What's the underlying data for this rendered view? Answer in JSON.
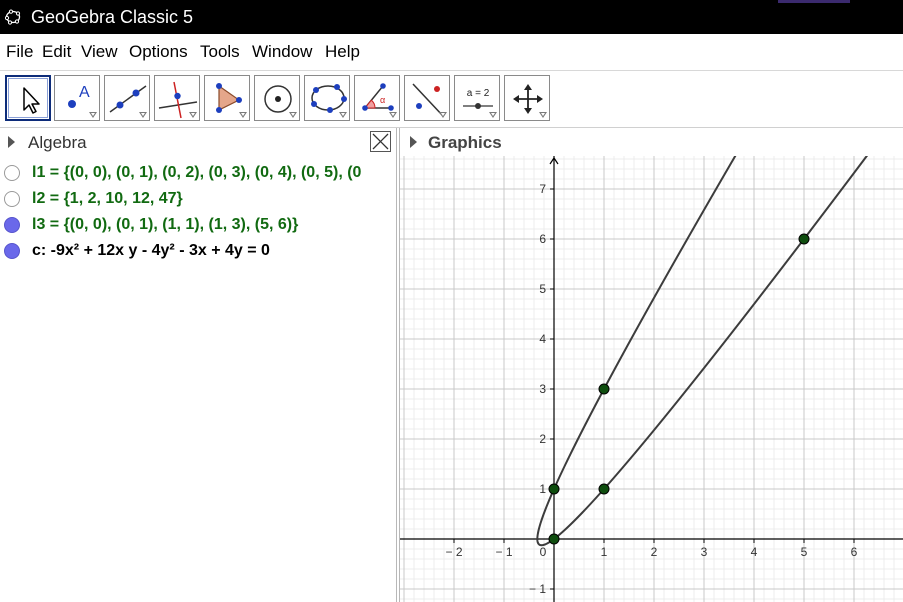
{
  "app": {
    "title": "GeoGebra Classic 5"
  },
  "menu": {
    "items": [
      "File",
      "Edit",
      "View",
      "Options",
      "Tools",
      "Window",
      "Help"
    ]
  },
  "toolbar": {
    "tools": [
      {
        "name": "move-tool",
        "selected": true
      },
      {
        "name": "point-tool",
        "label": "A"
      },
      {
        "name": "line-tool"
      },
      {
        "name": "perpendicular-line-tool"
      },
      {
        "name": "polygon-tool"
      },
      {
        "name": "circle-tool"
      },
      {
        "name": "conic-tool"
      },
      {
        "name": "angle-tool",
        "label": "α"
      },
      {
        "name": "reflect-tool"
      },
      {
        "name": "slider-tool",
        "label": "a = 2"
      },
      {
        "name": "move-graphics-view-tool"
      }
    ]
  },
  "algebra": {
    "header": "Algebra",
    "rows": [
      {
        "text": "l1 = {(0, 0), (0, 1), (0, 2), (0, 3), (0, 4), (0, 5), (0",
        "visible": false,
        "color": "green"
      },
      {
        "text": "l2 = {1, 2, 10, 12, 47}",
        "visible": false,
        "color": "green"
      },
      {
        "text": "l3 = {(0, 0), (0, 1), (1, 1), (1, 3), (5, 6)}",
        "visible": true,
        "color": "green"
      },
      {
        "text": "c: -9x² + 12x y - 4y² - 3x + 4y = 0",
        "visible": true,
        "color": "black"
      }
    ]
  },
  "graphics": {
    "header": "Graphics",
    "x_ticks": [
      {
        "value": -2,
        "label": "− 2"
      },
      {
        "value": -1,
        "label": "− 1"
      },
      {
        "value": 0,
        "label": "0"
      },
      {
        "value": 1,
        "label": "1"
      },
      {
        "value": 2,
        "label": "2"
      },
      {
        "value": 3,
        "label": "3"
      },
      {
        "value": 4,
        "label": "4"
      },
      {
        "value": 5,
        "label": "5"
      },
      {
        "value": 6,
        "label": "6"
      }
    ],
    "y_ticks": [
      {
        "value": -1,
        "label": "− 1"
      },
      {
        "value": 1,
        "label": "1"
      },
      {
        "value": 2,
        "label": "2"
      },
      {
        "value": 3,
        "label": "3"
      },
      {
        "value": 4,
        "label": "4"
      },
      {
        "value": 5,
        "label": "5"
      },
      {
        "value": 6,
        "label": "6"
      },
      {
        "value": 7,
        "label": "7"
      }
    ],
    "points": [
      [
        0,
        0
      ],
      [
        0,
        1
      ],
      [
        1,
        1
      ],
      [
        1,
        3
      ],
      [
        5,
        6
      ]
    ],
    "colors": {
      "grid_major": "#c8c8c8",
      "grid_minor": "#ececec",
      "axis": "#000000",
      "curve": "#3c3c3c",
      "point": "#0e4d0e"
    }
  },
  "chart_data": {
    "type": "scatter",
    "points": [
      {
        "x": 0,
        "y": 0
      },
      {
        "x": 0,
        "y": 1
      },
      {
        "x": 1,
        "y": 1
      },
      {
        "x": 1,
        "y": 3
      },
      {
        "x": 5,
        "y": 6
      }
    ],
    "curve": "-9x^2 + 12xy - 4y^2 - 3x + 4y = 0",
    "xlim": [
      -2.8,
      7.2
    ],
    "ylim": [
      -1.2,
      7.6
    ],
    "grid": true
  }
}
